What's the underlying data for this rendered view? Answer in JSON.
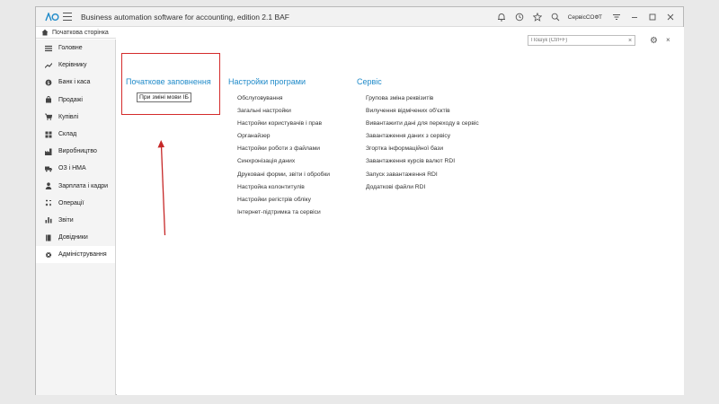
{
  "titlebar": {
    "app_title": "Business automation software for accounting, edition 2.1 BAF",
    "user": "СервісСОФТ"
  },
  "home_tab": {
    "label": "Початкова сторінка"
  },
  "sidebar": {
    "items": [
      {
        "label": "Головне",
        "icon": "list-icon"
      },
      {
        "label": "Керівнику",
        "icon": "trend-icon"
      },
      {
        "label": "Банк і каса",
        "icon": "coin-icon"
      },
      {
        "label": "Продажі",
        "icon": "bag-icon"
      },
      {
        "label": "Купівлі",
        "icon": "cart-icon"
      },
      {
        "label": "Склад",
        "icon": "grid-icon"
      },
      {
        "label": "Виробництво",
        "icon": "factory-icon"
      },
      {
        "label": "ОЗ і НМА",
        "icon": "truck-icon"
      },
      {
        "label": "Зарплата і кадри",
        "icon": "person-icon"
      },
      {
        "label": "Операції",
        "icon": "calc-icon"
      },
      {
        "label": "Звіти",
        "icon": "bar-chart-icon"
      },
      {
        "label": "Довідники",
        "icon": "book-icon"
      },
      {
        "label": "Адміністрування",
        "icon": "gear-icon",
        "active": true
      }
    ]
  },
  "search": {
    "placeholder": "Пошук (Ctrl+F)"
  },
  "sections": {
    "initial_fill": {
      "title": "Початкове заповнення",
      "button_label": "При зміні мови ІБ"
    },
    "program_settings": {
      "title": "Настройки програми",
      "links": [
        "Обслуговування",
        "Загальні настройки",
        "Настройки користувачів і прав",
        "Органайзер",
        "Настройки роботи з файлами",
        "Синхронізація даних",
        "Друковані форми, звіти і обробки",
        "Настройка колонтитулів",
        "Настройки регістрів обліку",
        "Інтернет-підтримка та сервіси"
      ]
    },
    "service": {
      "title": "Сервіс",
      "links": [
        "Групова зміна реквізитів",
        "Вилучення відмічених об'єктів",
        "Вивантажити дані для переходу в сервіс",
        "Завантаження даних з сервісу",
        "Згортка інформаційної бази",
        "Завантаження курсів валют RDI",
        "Запуск завантаження RDI",
        "Додаткові файли RDI"
      ]
    }
  },
  "colors": {
    "accent": "#1f8ac9",
    "highlight": "#d42b2b"
  }
}
